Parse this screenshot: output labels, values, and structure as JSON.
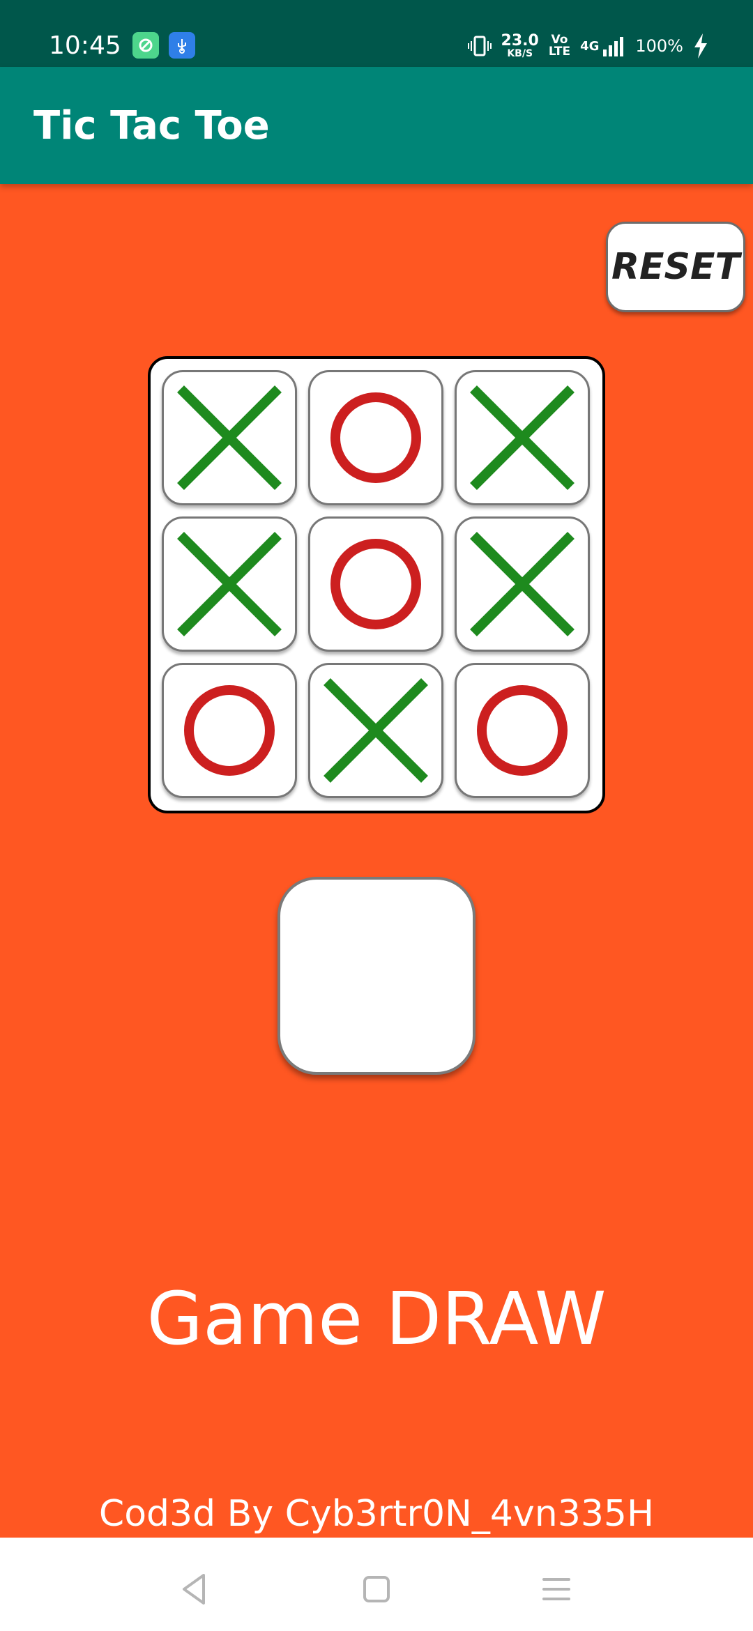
{
  "status_bar": {
    "time": "10:45",
    "speed_value": "23.0",
    "speed_unit": "KB/S",
    "volte_top": "Vo",
    "volte_bottom": "LTE",
    "network": "4G",
    "battery": "100%",
    "icons": [
      "vpn-icon",
      "usb-icon",
      "vibrate-icon",
      "signal-icon",
      "charging-icon"
    ]
  },
  "app_bar": {
    "title": "Tic Tac Toe"
  },
  "reset_button": {
    "label": "RESET"
  },
  "board": {
    "cells": [
      "X",
      "O",
      "X",
      "X",
      "O",
      "X",
      "O",
      "X",
      "O"
    ]
  },
  "game_status": "Game DRAW",
  "credit": "Cod3d By Cyb3rtr0N_4vn335H",
  "colors": {
    "background": "#FF5722",
    "app_bar": "#008577",
    "status_bar": "#00574B",
    "x_mark": "#1E8A1E",
    "o_mark": "#CC1F1F"
  },
  "nav_bar": {
    "icons": [
      "back-icon",
      "home-icon",
      "recents-icon"
    ]
  }
}
